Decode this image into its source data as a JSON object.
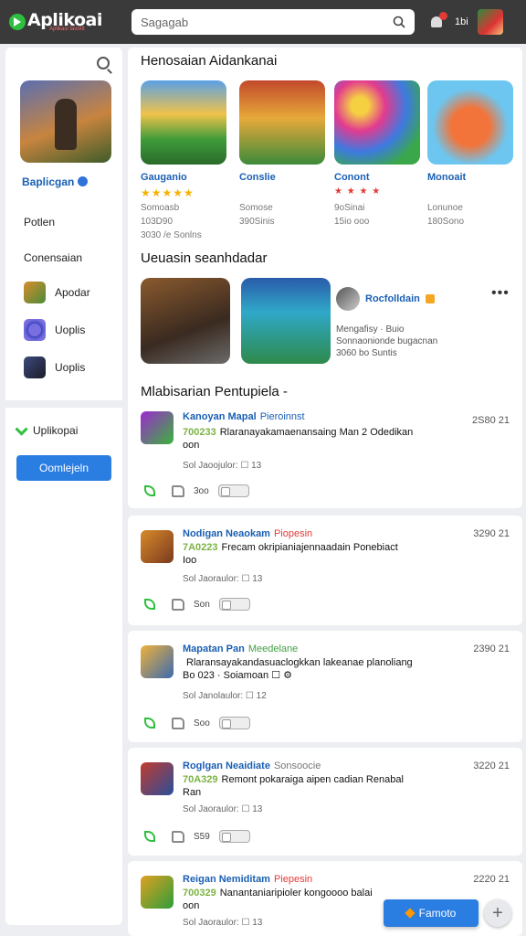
{
  "header": {
    "logo_text": "Aplikoai",
    "logo_sub": "Aplikasi favorit",
    "search_placeholder": "Sagagab",
    "notif_count": "1bi"
  },
  "sidebar": {
    "app_title": "Baplicgan",
    "links": [
      "Potlen",
      "Conensaian"
    ],
    "items": [
      {
        "label": "Apodar",
        "icon": "game-icon"
      },
      {
        "label": "Uoplis",
        "icon": "app-icon"
      },
      {
        "label": "Uoplis",
        "icon": "game-icon"
      }
    ],
    "version_label": "Uplikopai",
    "button_label": "Oomlejeln"
  },
  "main": {
    "featured_title": "Henosaian Aidankanai",
    "featured": [
      {
        "name": "Gauganio",
        "stars": "★★★★★",
        "meta1": "Somoasb",
        "meta2": "103D90",
        "meta3": "3030 /e   Sonlns"
      },
      {
        "name": "Conslie",
        "stars": "",
        "meta1": "Somose",
        "meta2": "390Sinis",
        "meta3": ""
      },
      {
        "name": "Conont",
        "stars": "★ ★ ★ ★",
        "meta1": "9oSinai",
        "meta2": "15io ooo",
        "meta3": ""
      },
      {
        "name": "Monoait",
        "stars": "",
        "meta1": "Lonunoe",
        "meta2": "180Sono",
        "meta3": ""
      }
    ],
    "recommended_title": "Ueuasin seanhdadar",
    "rec_dev": "Rocfolldain",
    "rec_desc": [
      "Mengafisy · Buio",
      "Sonnaonionde bugacnan",
      "3060 bo     Suntis"
    ],
    "reviews_title": "Mlabisarian Pentupiela -"
  },
  "reviews": [
    {
      "name": "Kanoyan Mapal",
      "tag": "Pieroinnst",
      "date": "2S80 21",
      "stars": "700233",
      "text": "Rlaranayakamaenansaing Man 2 Odedikan",
      "line2": "oon",
      "sub": "Sol   Jaoojulor:   ☐   13",
      "likes": "3oo"
    },
    {
      "name": "Nodigan Neaokam",
      "tag": "Piopesin",
      "date": "3290 21",
      "stars": "7A0223",
      "text": "Frecam okripianiajennaadain Ponebiact",
      "line2": "Ioo",
      "sub": "Sol   Jaoraulor:   ☐   13",
      "likes": "Son"
    },
    {
      "name": "Mapatan Pan",
      "tag": "Meedelane",
      "date": "2390 21",
      "stars": "",
      "text": "Rlaransayakandasuaclogkkan lakeanae planoliang",
      "line2": "Bo 023 ·  Soiamoan ☐ ⚙",
      "sub": "Sol   Janolaulor:   ☐   12",
      "likes": "Soo"
    },
    {
      "name": "Roglgan Neaidiate",
      "tag": "Sonsoocie",
      "date": "3220 21",
      "stars": "70A329",
      "text": "Remont pokaraiga aipen cadian Renabal",
      "line2": "Ran",
      "sub": "Sol   Jaoraulor:   ☐   13",
      "likes": "S59"
    },
    {
      "name": "Reigan Nemiditam",
      "tag": "Piepesin",
      "date": "2220 21",
      "stars": "700329",
      "text": "Nanantaniaripioler kongoooo balai",
      "line2": "oon",
      "sub": "Sol   Jaoraulor:   ☐   13",
      "likes": ""
    }
  ],
  "fab_label": "Famoto"
}
